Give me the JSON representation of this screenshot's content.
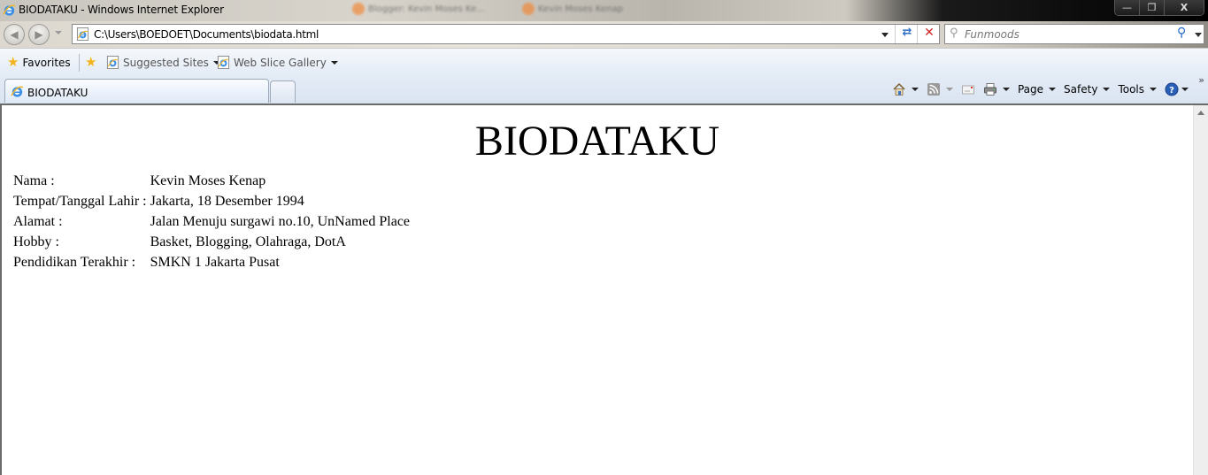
{
  "window": {
    "title": "BIODATAKU - Windows Internet Explorer",
    "background_tabs": [
      "Blogger: Kevin Moses Ke...",
      "Kevin Moses Kenap"
    ],
    "controls": {
      "minimize": "—",
      "restore": "❐",
      "close": "X"
    }
  },
  "address_bar": {
    "url": "C:\\Users\\BOEDOET\\Documents\\biodata.html",
    "refresh_icon": "refresh-icon",
    "stop_icon": "stop-icon"
  },
  "search": {
    "placeholder": "Funmoods",
    "value": ""
  },
  "favorites_bar": {
    "favorites_label": "Favorites",
    "items": [
      {
        "label": "Suggested Sites",
        "icon": "ie-page-icon"
      },
      {
        "label": "Web Slice Gallery",
        "icon": "ie-page-icon"
      }
    ]
  },
  "tabs": [
    {
      "label": "BIODATAKU",
      "active": true
    }
  ],
  "command_bar": {
    "items": [
      {
        "name": "home",
        "label": ""
      },
      {
        "name": "feeds",
        "label": ""
      },
      {
        "name": "mail",
        "label": ""
      },
      {
        "name": "print",
        "label": ""
      },
      {
        "name": "page",
        "label": "Page"
      },
      {
        "name": "safety",
        "label": "Safety"
      },
      {
        "name": "tools",
        "label": "Tools"
      },
      {
        "name": "help",
        "label": ""
      }
    ],
    "overflow": "»"
  },
  "page": {
    "heading": "BIODATAKU",
    "rows": [
      {
        "label": "Nama :",
        "value": "Kevin Moses Kenap"
      },
      {
        "label": "Tempat/Tanggal Lahir :",
        "value": "Jakarta, 18 Desember 1994"
      },
      {
        "label": "Alamat :",
        "value": "Jalan Menuju surgawi no.10, UnNamed Place"
      },
      {
        "label": "Hobby :",
        "value": "Basket, Blogging, Olahraga, DotA"
      },
      {
        "label": "Pendidikan Terakhir :",
        "value": "SMKN 1 Jakarta Pusat"
      }
    ]
  },
  "colors": {
    "accent_blue": "#2b6fc4",
    "stop_red": "#d02828",
    "favorites_star": "#f4b21b"
  }
}
